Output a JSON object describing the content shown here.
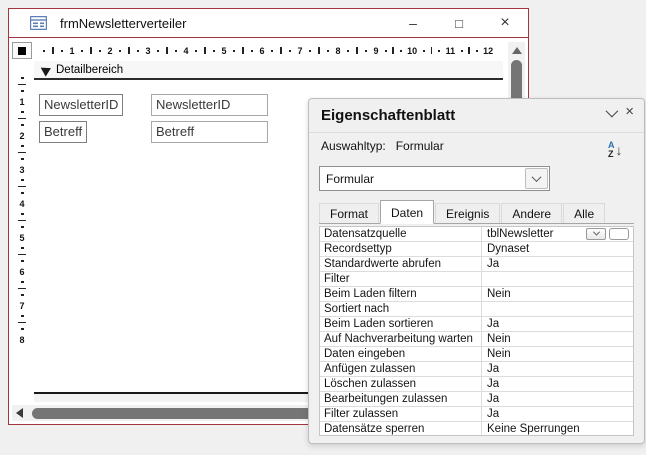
{
  "window": {
    "title": "frmNewsletterverteiler"
  },
  "design": {
    "section_label": "Detailbereich",
    "h_ruler": [
      "1",
      "2",
      "3",
      "4",
      "5",
      "6",
      "7",
      "8",
      "9",
      "10",
      "11",
      "12"
    ],
    "v_ruler": [
      "1",
      "2",
      "3",
      "4",
      "5",
      "6",
      "7",
      "8"
    ],
    "fields": [
      {
        "label": "NewsletterID",
        "value": "NewsletterID"
      },
      {
        "label": "Betreff",
        "value": "Betreff"
      }
    ]
  },
  "panel": {
    "title": "Eigenschaftenblatt",
    "selection_type_label": "Auswahltyp:",
    "selection_type_value": "Formular",
    "combo_value": "Formular",
    "tabs": [
      {
        "label": "Format",
        "active": false
      },
      {
        "label": "Daten",
        "active": true
      },
      {
        "label": "Ereignis",
        "active": false
      },
      {
        "label": "Andere",
        "active": false
      },
      {
        "label": "Alle",
        "active": false
      }
    ],
    "rows": [
      {
        "label": "Datensatzquelle",
        "value": "tblNewsletter",
        "has_buttons": true
      },
      {
        "label": "Recordsettyp",
        "value": "Dynaset"
      },
      {
        "label": "Standardwerte abrufen",
        "value": "Ja"
      },
      {
        "label": "Filter",
        "value": ""
      },
      {
        "label": "Beim Laden filtern",
        "value": "Nein"
      },
      {
        "label": "Sortiert nach",
        "value": ""
      },
      {
        "label": "Beim Laden sortieren",
        "value": "Ja"
      },
      {
        "label": "Auf Nachverarbeitung warten",
        "value": "Nein"
      },
      {
        "label": "Daten eingeben",
        "value": "Nein"
      },
      {
        "label": "Anfügen zulassen",
        "value": "Ja"
      },
      {
        "label": "Löschen zulassen",
        "value": "Ja"
      },
      {
        "label": "Bearbeitungen zulassen",
        "value": "Ja"
      },
      {
        "label": "Filter zulassen",
        "value": "Ja"
      },
      {
        "label": "Datensätze sperren",
        "value": "Keine Sperrungen"
      }
    ],
    "row_buttons": {
      "ellipsis": "…"
    }
  },
  "icons": {
    "window_minimize": "–",
    "window_maximize": "□",
    "window_close": "×",
    "panel_close": "×",
    "sort_a": "A",
    "sort_z": "Z",
    "sort_arrow": "↓"
  },
  "colors": {
    "accent_red": "#a4343f",
    "sort_icon_blue": "#2b6cb0",
    "scrollbar_thumb": "#757575"
  }
}
